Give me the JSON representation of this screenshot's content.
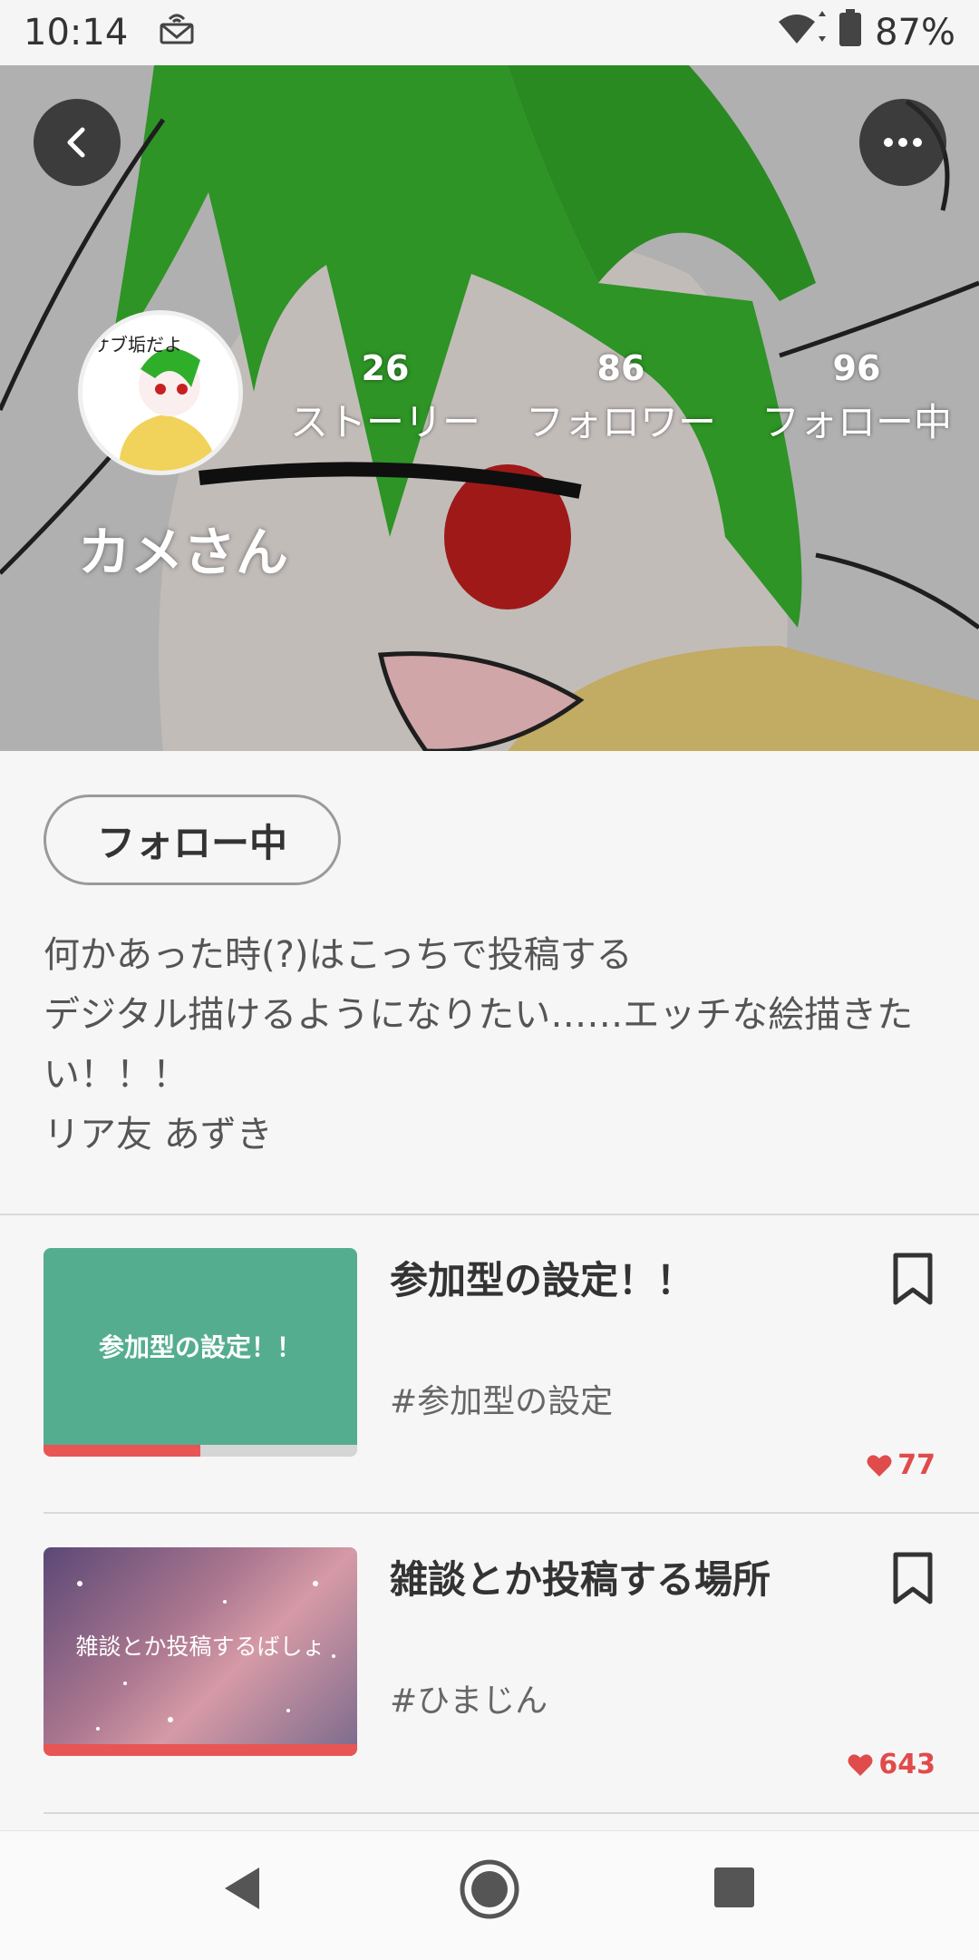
{
  "status_bar": {
    "time": "10:14",
    "battery": "87%",
    "icons": [
      "notification-icon",
      "wifi-icon",
      "battery-icon"
    ]
  },
  "header": {
    "back_icon": "back-arrow-icon",
    "more_icon": "more-dots-icon",
    "avatar_text": "サブ垢だよ",
    "username": "カメさん",
    "stats": [
      {
        "value": "26",
        "label": "ストーリー"
      },
      {
        "value": "86",
        "label": "フォロワー"
      },
      {
        "value": "96",
        "label": "フォロー中"
      }
    ]
  },
  "follow_button": "フォロー中",
  "bio": [
    "何かあった時(?)はこっちで投稿する",
    "デジタル描けるようになりたい……エッチな絵描きた",
    "い！！！",
    "リア友 あずき"
  ],
  "stories": [
    {
      "thumb_text": "参加型の設定！！",
      "thumb_color": "#55ad8f",
      "progress": 0.5,
      "title": "参加型の設定！！",
      "tag": "#参加型の設定",
      "likes": "77"
    },
    {
      "thumb_text": "雑談とか投稿するばしょ",
      "progress": 1.0,
      "title": "雑談とか投稿する場所",
      "tag": "#ひまじん",
      "likes": "643"
    }
  ],
  "colors": {
    "accent_red": "#e04b4b",
    "progress_red": "#e85555"
  },
  "navbar_icons": [
    "nav-back-icon",
    "nav-home-icon",
    "nav-recents-icon"
  ]
}
